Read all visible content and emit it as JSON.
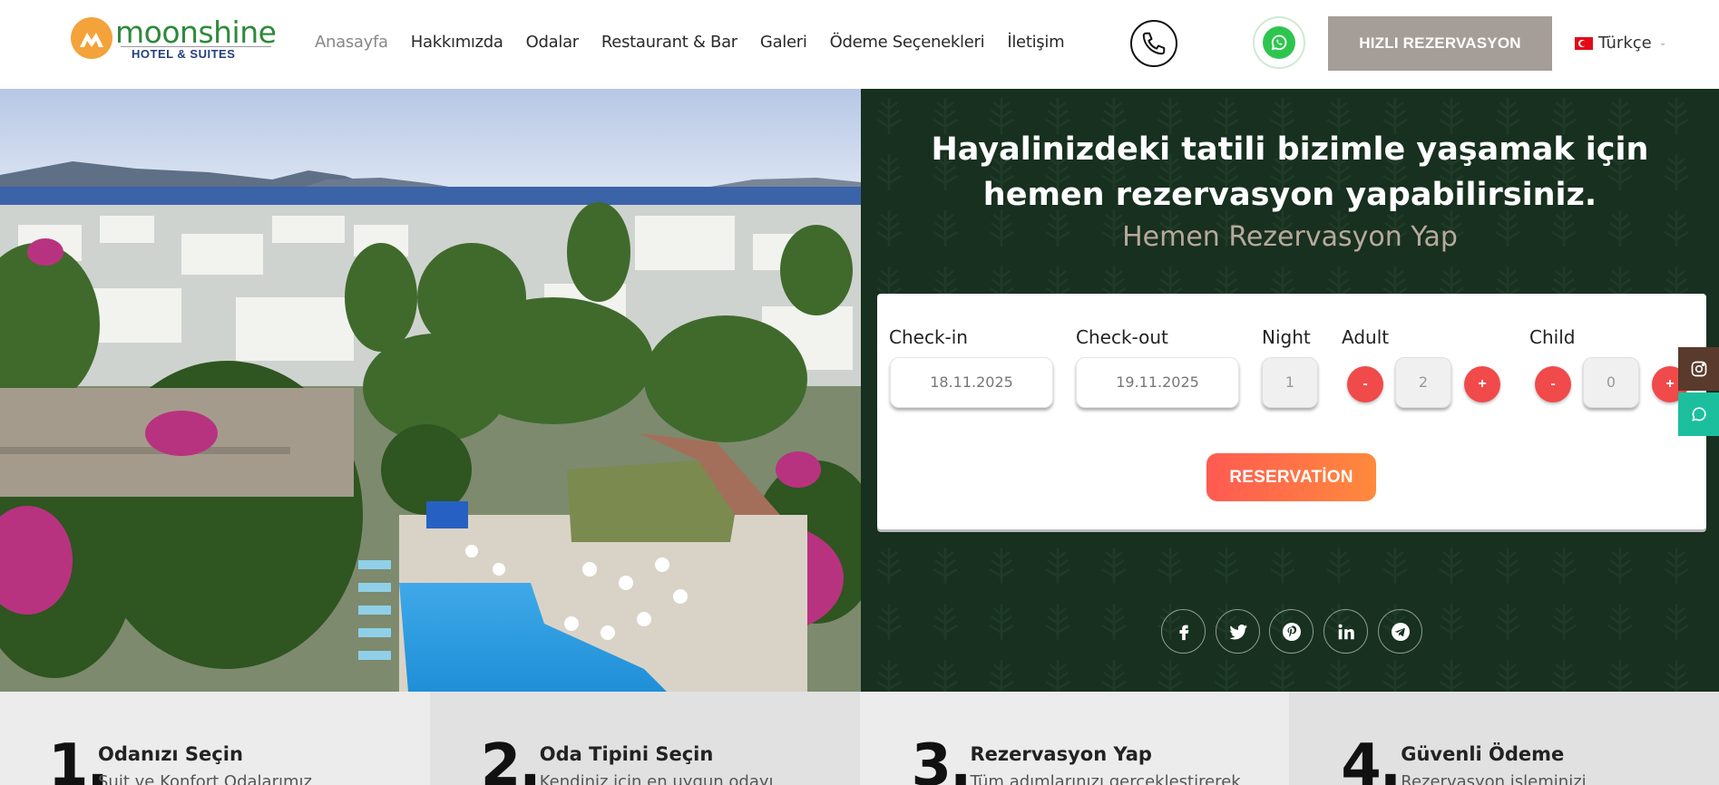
{
  "brand": {
    "name": "moonshine",
    "subtitle": "HOTEL & SUITES",
    "colors": {
      "logo_orange": "#f4a23a",
      "name_green": "#2e8a3b",
      "subtitle_blue": "#24407a"
    }
  },
  "nav": {
    "items": [
      {
        "label": "Anasayfa",
        "active": true
      },
      {
        "label": "Hakkımızda",
        "active": false
      },
      {
        "label": "Odalar",
        "active": false
      },
      {
        "label": "Restaurant & Bar",
        "active": false
      },
      {
        "label": "Galeri",
        "active": false
      },
      {
        "label": "Ödeme Seçenekleri",
        "active": false
      },
      {
        "label": "İletişim",
        "active": false
      }
    ]
  },
  "header": {
    "phone_icon": "phone-icon",
    "whatsapp_icon": "whatsapp-icon",
    "quick_reservation_label": "HIZLI REZERVASYON",
    "language": "Türkçe",
    "language_flag": "turkey-flag-icon"
  },
  "hero": {
    "image_icon": "hotel-aerial-photo",
    "title_line1": "Hayalinizdeki tatili bizimle yaşamak için",
    "title_line2": "hemen rezervasyon yapabilirsiniz.",
    "subtitle": "Hemen Rezervasyon Yap",
    "panel_color": "#17301f"
  },
  "booking": {
    "checkin_label": "Check-in",
    "checkin_value": "18.11.2025",
    "checkout_label": "Check-out",
    "checkout_value": "19.11.2025",
    "night_label": "Night",
    "night_value": "1",
    "adult_label": "Adult",
    "adult_value": "2",
    "child_label": "Child",
    "child_value": "0",
    "minus_label": "-",
    "plus_label": "+",
    "submit_label": "RESERVATİON",
    "step_color": "#f04a4a"
  },
  "social": {
    "items": [
      "facebook-icon",
      "twitter-icon",
      "pinterest-icon",
      "linkedin-icon",
      "telegram-icon"
    ]
  },
  "side_tabs": {
    "instagram_icon": "instagram-icon",
    "whatsapp_icon": "whatsapp-icon",
    "instagram_color": "#5a3a2c",
    "whatsapp_color": "#1bbf9e"
  },
  "steps": [
    {
      "number": "1.",
      "title": "Odanızı Seçin",
      "desc": "Suit ve Konfort Odalarımız"
    },
    {
      "number": "2.",
      "title": "Oda Tipini Seçin",
      "desc": "Kendiniz için en uygun odayı"
    },
    {
      "number": "3.",
      "title": "Rezervasyon Yap",
      "desc": "Tüm adımlarınızı gerçekleştirerek"
    },
    {
      "number": "4.",
      "title": "Güvenli Ödeme",
      "desc": "Rezervasyon işleminizi"
    }
  ]
}
